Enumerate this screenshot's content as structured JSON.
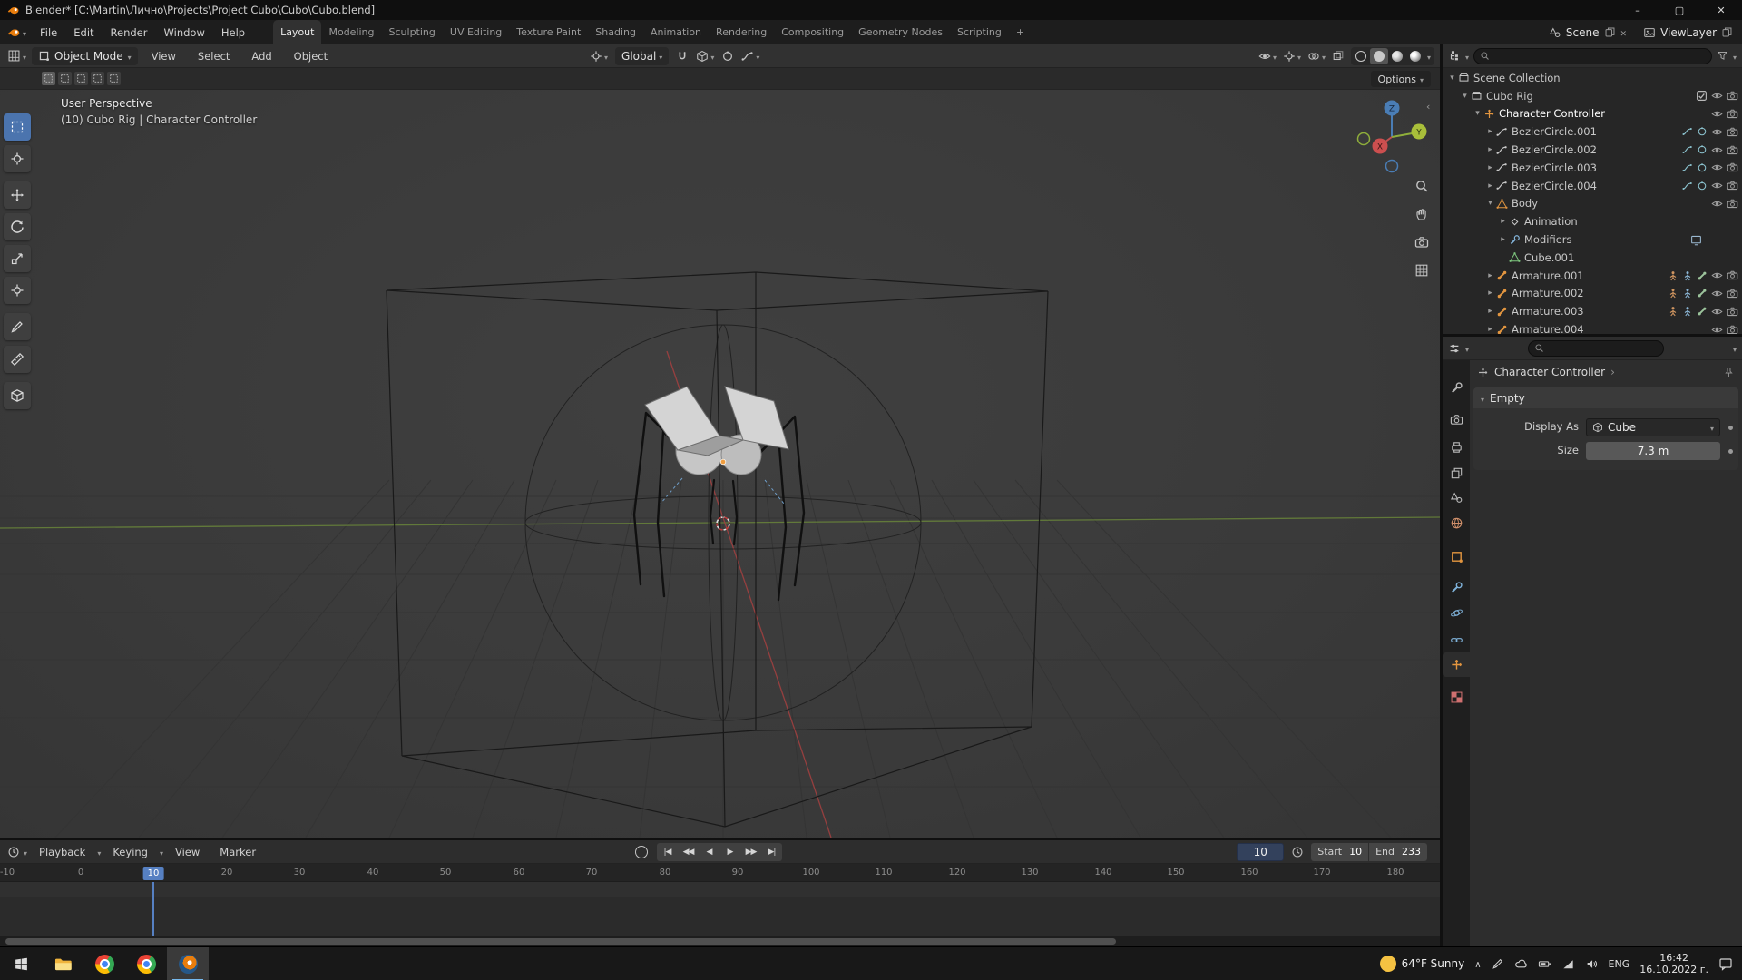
{
  "titlebar": {
    "title": "Blender* [C:\\Martin\\Лично\\Projects\\Project Cubo\\Cubo\\Cubo.blend]"
  },
  "topbar": {
    "menus": [
      "File",
      "Edit",
      "Render",
      "Window",
      "Help"
    ],
    "workspaces": [
      "Layout",
      "Modeling",
      "Sculpting",
      "UV Editing",
      "Texture Paint",
      "Shading",
      "Animation",
      "Rendering",
      "Compositing",
      "Geometry Nodes",
      "Scripting"
    ],
    "add_tab": "+",
    "scene": {
      "label": "Scene"
    },
    "viewlayer": {
      "label": "ViewLayer"
    }
  },
  "viewport_header": {
    "mode": "Object Mode",
    "menus": [
      "View",
      "Select",
      "Add",
      "Object"
    ],
    "orientation": "Global",
    "options": "Options"
  },
  "viewport": {
    "perspective_label": "User Perspective",
    "info_label": "(10) Cubo Rig | Character Controller",
    "axis": {
      "x": "X",
      "y": "Y",
      "z": "Z"
    }
  },
  "outliner": {
    "items": [
      {
        "label": "Scene Collection",
        "icon": "collection"
      },
      {
        "label": "Cubo Rig",
        "icon": "collection"
      },
      {
        "label": "Character Controller",
        "icon": "empty"
      },
      {
        "label": "BezierCircle.001",
        "icon": "curve"
      },
      {
        "label": "BezierCircle.002",
        "icon": "curve"
      },
      {
        "label": "BezierCircle.003",
        "icon": "curve"
      },
      {
        "label": "BezierCircle.004",
        "icon": "curve"
      },
      {
        "label": "Body",
        "icon": "mesh-object"
      },
      {
        "label": "Animation",
        "icon": "animation"
      },
      {
        "label": "Modifiers",
        "icon": "modifier"
      },
      {
        "label": "Cube.001",
        "icon": "mesh-data"
      },
      {
        "label": "Armature.001",
        "icon": "armature"
      },
      {
        "label": "Armature.002",
        "icon": "armature"
      },
      {
        "label": "Armature.003",
        "icon": "armature"
      },
      {
        "label": "Armature.004",
        "icon": "armature"
      }
    ]
  },
  "properties": {
    "breadcrumb": "Character Controller",
    "panel_title": "Empty",
    "display_as": {
      "label": "Display As",
      "value": "Cube"
    },
    "size": {
      "label": "Size",
      "value": "7.3 m"
    }
  },
  "timeline": {
    "menus": [
      "Playback",
      "Keying",
      "View",
      "Marker"
    ],
    "current_frame": "10",
    "playhead_label": "10",
    "start_label": "Start",
    "start_value": "10",
    "end_label": "End",
    "end_value": "233",
    "ticks": [
      "-10",
      "0",
      "10",
      "20",
      "30",
      "40",
      "50",
      "60",
      "70",
      "80",
      "90",
      "100",
      "110",
      "120",
      "130",
      "140",
      "150",
      "160",
      "170",
      "180"
    ]
  },
  "taskbar": {
    "weather": "64°F Sunny",
    "language": "ENG",
    "time": "16:42",
    "date": "16.10.2022 г."
  }
}
